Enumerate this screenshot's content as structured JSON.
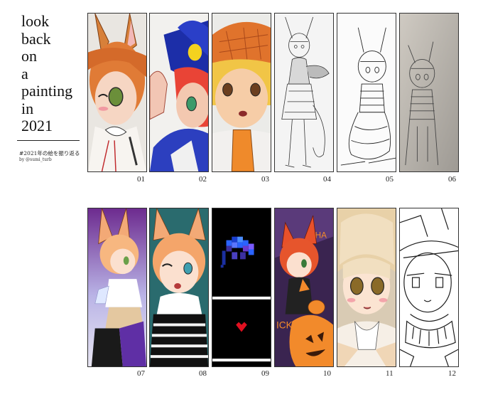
{
  "title_lines": [
    "look",
    "back",
    "on",
    "a",
    "painting",
    "in",
    "2021"
  ],
  "hashtag": "#2021年の絵を振り返る",
  "byline": "by @sumi_turb",
  "panels": [
    {
      "num": "01",
      "style": "color-marker"
    },
    {
      "num": "02",
      "style": "color-marker"
    },
    {
      "num": "03",
      "style": "color-marker"
    },
    {
      "num": "04",
      "style": "pencil-sketch"
    },
    {
      "num": "05",
      "style": "pencil-sketch"
    },
    {
      "num": "06",
      "style": "pencil-sketch"
    },
    {
      "num": "07",
      "style": "digital-color"
    },
    {
      "num": "08",
      "style": "digital-color"
    },
    {
      "num": "09",
      "style": "pixel-dark"
    },
    {
      "num": "10",
      "style": "digital-color"
    },
    {
      "num": "11",
      "style": "digital-color"
    },
    {
      "num": "12",
      "style": "lineart"
    }
  ],
  "panel_text": {
    "p10_top": "HA",
    "p10_bottom": "ICK"
  }
}
